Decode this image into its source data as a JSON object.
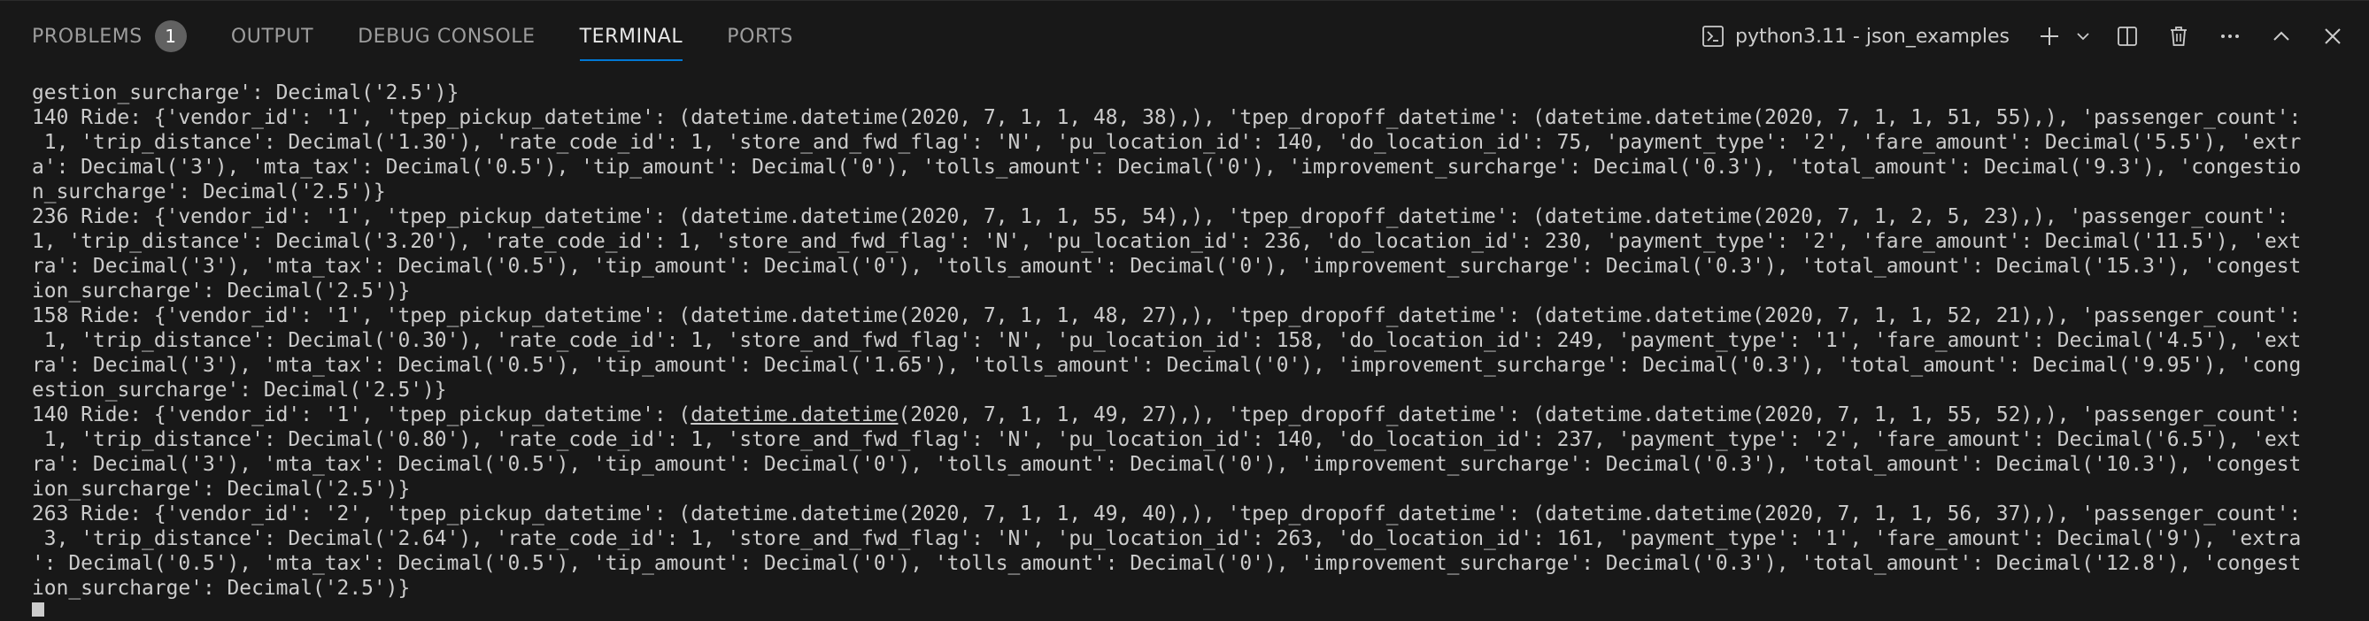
{
  "tabs": [
    {
      "label": "PROBLEMS",
      "badge": "1"
    },
    {
      "label": "OUTPUT"
    },
    {
      "label": "DEBUG CONSOLE"
    },
    {
      "label": "TERMINAL"
    },
    {
      "label": "PORTS"
    }
  ],
  "active_tab": "TERMINAL",
  "terminal": {
    "name": "python3.11 - json_examples",
    "lines": [
      "gestion_surcharge': Decimal('2.5')}",
      "140 Ride: {'vendor_id': '1', 'tpep_pickup_datetime': (datetime.datetime(2020, 7, 1, 1, 48, 38),), 'tpep_dropoff_datetime': (datetime.datetime(2020, 7, 1, 1, 51, 55),), 'passenger_count':",
      " 1, 'trip_distance': Decimal('1.30'), 'rate_code_id': 1, 'store_and_fwd_flag': 'N', 'pu_location_id': 140, 'do_location_id': 75, 'payment_type': '2', 'fare_amount': Decimal('5.5'), 'extr",
      "a': Decimal('3'), 'mta_tax': Decimal('0.5'), 'tip_amount': Decimal('0'), 'tolls_amount': Decimal('0'), 'improvement_surcharge': Decimal('0.3'), 'total_amount': Decimal('9.3'), 'congestio",
      "n_surcharge': Decimal('2.5')}",
      "236 Ride: {'vendor_id': '1', 'tpep_pickup_datetime': (datetime.datetime(2020, 7, 1, 1, 55, 54),), 'tpep_dropoff_datetime': (datetime.datetime(2020, 7, 1, 2, 5, 23),), 'passenger_count':",
      "1, 'trip_distance': Decimal('3.20'), 'rate_code_id': 1, 'store_and_fwd_flag': 'N', 'pu_location_id': 236, 'do_location_id': 230, 'payment_type': '2', 'fare_amount': Decimal('11.5'), 'ext",
      "ra': Decimal('3'), 'mta_tax': Decimal('0.5'), 'tip_amount': Decimal('0'), 'tolls_amount': Decimal('0'), 'improvement_surcharge': Decimal('0.3'), 'total_amount': Decimal('15.3'), 'congest",
      "ion_surcharge': Decimal('2.5')}",
      "158 Ride: {'vendor_id': '1', 'tpep_pickup_datetime': (datetime.datetime(2020, 7, 1, 1, 48, 27),), 'tpep_dropoff_datetime': (datetime.datetime(2020, 7, 1, 1, 52, 21),), 'passenger_count':",
      " 1, 'trip_distance': Decimal('0.30'), 'rate_code_id': 1, 'store_and_fwd_flag': 'N', 'pu_location_id': 158, 'do_location_id': 249, 'payment_type': '1', 'fare_amount': Decimal('4.5'), 'ext",
      "ra': Decimal('3'), 'mta_tax': Decimal('0.5'), 'tip_amount': Decimal('1.65'), 'tolls_amount': Decimal('0'), 'improvement_surcharge': Decimal('0.3'), 'total_amount': Decimal('9.95'), 'cong",
      "estion_surcharge': Decimal('2.5')}",
      {
        "pre": "140 Ride: {'vendor_id': '1', 'tpep_pickup_datetime': (",
        "link": "datetime.datetime",
        "post": "(2020, 7, 1, 1, 49, 27),), 'tpep_dropoff_datetime': (datetime.datetime(2020, 7, 1, 1, 55, 52),), 'passenger_count':"
      },
      " 1, 'trip_distance': Decimal('0.80'), 'rate_code_id': 1, 'store_and_fwd_flag': 'N', 'pu_location_id': 140, 'do_location_id': 237, 'payment_type': '2', 'fare_amount': Decimal('6.5'), 'ext",
      "ra': Decimal('3'), 'mta_tax': Decimal('0.5'), 'tip_amount': Decimal('0'), 'tolls_amount': Decimal('0'), 'improvement_surcharge': Decimal('0.3'), 'total_amount': Decimal('10.3'), 'congest",
      "ion_surcharge': Decimal('2.5')}",
      "263 Ride: {'vendor_id': '2', 'tpep_pickup_datetime': (datetime.datetime(2020, 7, 1, 1, 49, 40),), 'tpep_dropoff_datetime': (datetime.datetime(2020, 7, 1, 1, 56, 37),), 'passenger_count':",
      " 3, 'trip_distance': Decimal('2.64'), 'rate_code_id': 1, 'store_and_fwd_flag': 'N', 'pu_location_id': 263, 'do_location_id': 161, 'payment_type': '1', 'fare_amount': Decimal('9'), 'extra",
      "': Decimal('0.5'), 'mta_tax': Decimal('0.5'), 'tip_amount': Decimal('0'), 'tolls_amount': Decimal('0'), 'improvement_surcharge': Decimal('0.3'), 'total_amount': Decimal('12.8'), 'congest",
      "ion_surcharge': Decimal('2.5')}"
    ]
  },
  "icons": {
    "terminal": "terminal-icon",
    "add": "plus-icon",
    "dropdown": "chevron-down-icon",
    "split": "split-terminal-icon",
    "trash": "trash-icon",
    "more": "more-actions-icon",
    "maximize": "chevron-up-icon",
    "close": "close-icon"
  },
  "colors": {
    "background": "#181818",
    "text": "#cccccc",
    "active_underline": "#0078d4",
    "badge": "#616161"
  }
}
